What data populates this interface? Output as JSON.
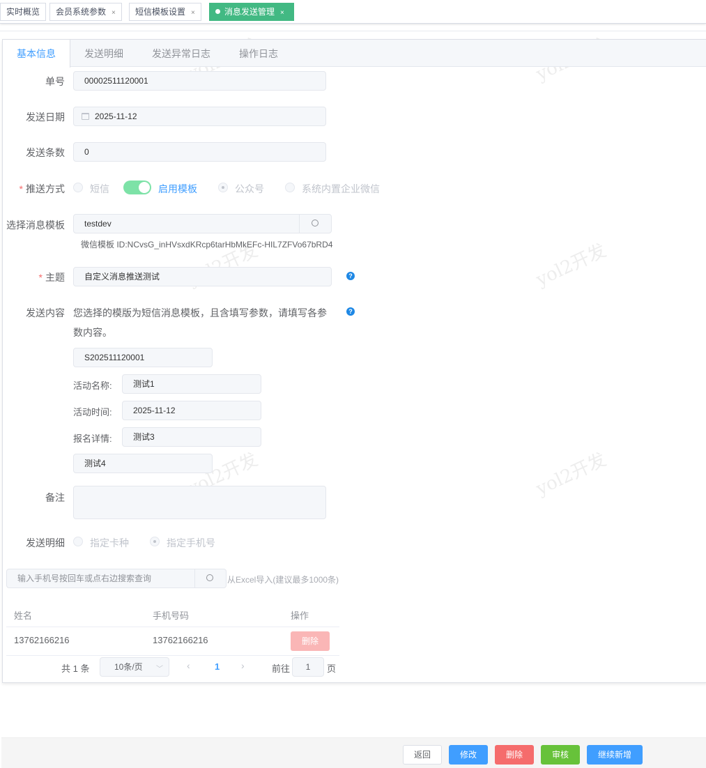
{
  "tags": [
    {
      "label": "实时概览"
    },
    {
      "label": "会员系统参数"
    },
    {
      "label": "短信模板设置"
    },
    {
      "label": "消息发送管理"
    }
  ],
  "tag_close": "×",
  "tabs": [
    "基本信息",
    "发送明细",
    "发送异常日志",
    "操作日志"
  ],
  "form": {
    "order_no": {
      "label": "单号",
      "value": "00002511120001"
    },
    "send_date": {
      "label": "发送日期",
      "value": "2025-11-12"
    },
    "send_count": {
      "label": "发送条数",
      "value": "0"
    },
    "push_method": {
      "label": "推送方式",
      "options": [
        "短信",
        "启用模板",
        "公众号",
        "系统内置企业微信"
      ],
      "template_enabled": true,
      "selected": "公众号"
    },
    "template": {
      "label": "选择消息模板",
      "value": "testdev",
      "hint": "微信模板 ID:NCvsG_inHVsxdKRcp6tarHbMkEFc-HIL7ZFVo67bRD4"
    },
    "subject": {
      "label": "主题",
      "value": "自定义消息推送测试"
    },
    "content": {
      "label": "发送内容",
      "notice_line1": "您选择的模版为短信消息模板，且含填写参数，请填写各参",
      "notice_line2": "数内容。",
      "first": "S202511120001",
      "params": [
        {
          "label": "活动名称:",
          "value": "测试1"
        },
        {
          "label": "活动时间:",
          "value": "2025-11-12"
        },
        {
          "label": "报名详情:",
          "value": "测试3"
        }
      ],
      "last": "测试4"
    },
    "remark": {
      "label": "备注",
      "value": ""
    },
    "detail": {
      "label": "发送明细",
      "options": [
        "指定卡种",
        "指定手机号"
      ],
      "selected": "指定手机号"
    }
  },
  "phone_search": {
    "placeholder": "输入手机号按回车或点右边搜索查询",
    "import_label": "从Excel导入(建议最多1000条)"
  },
  "table": {
    "headers": [
      "姓名",
      "手机号码",
      "操作"
    ],
    "rows": [
      {
        "name": "13762166216",
        "phone": "13762166216",
        "action": "删除"
      }
    ]
  },
  "pagination": {
    "total": "共 1 条",
    "page_size": "10条/页",
    "current": "1",
    "goto_label": "前往",
    "goto_value": "1",
    "page_suffix": "页"
  },
  "footer": {
    "back": "返回",
    "edit": "修改",
    "delete": "删除",
    "audit": "审核",
    "add_more": "继续新增"
  },
  "watermark": "yol2开发",
  "colors": {
    "accent": "#409eff",
    "tag_active": "#42b983",
    "danger": "#f56c6c",
    "success": "#67c23a"
  }
}
